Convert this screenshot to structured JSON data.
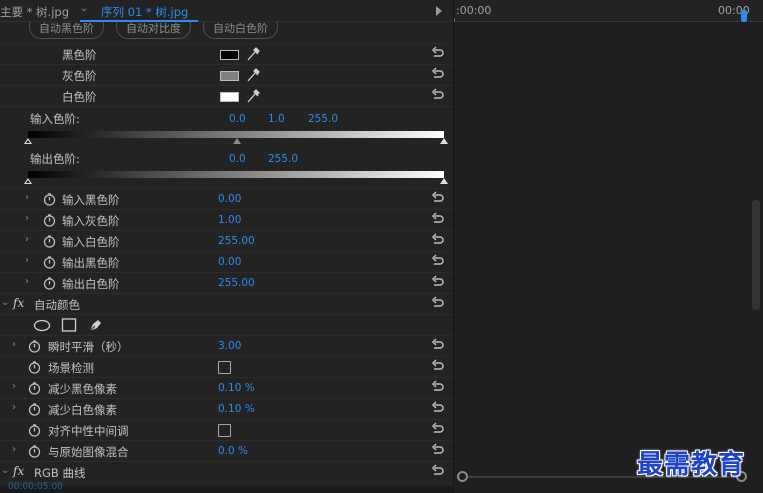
{
  "tabs": {
    "master": "主要 * 树.jpg",
    "sequence": "序列 01 * 树.jpg"
  },
  "timeline": {
    "start_tc": ":00:00",
    "end_tc": "00:00",
    "bottom_tc": "00:00:05:00"
  },
  "auto_buttons": [
    "自动黑色阶",
    "自动对比度",
    "自动白色阶"
  ],
  "levels": {
    "black_label": "黑色阶",
    "gray_label": "灰色阶",
    "white_label": "白色阶",
    "black_color": "#000000",
    "gray_color": "#808080",
    "white_color": "#ffffff"
  },
  "input_levels": {
    "label": "输入色阶:",
    "low": "0.0",
    "gamma": "1.0",
    "high": "255.0"
  },
  "output_levels": {
    "label": "输出色阶:",
    "low": "0.0",
    "high": "255.0"
  },
  "level_params": [
    {
      "label": "输入黑色阶",
      "value": "0.00"
    },
    {
      "label": "输入灰色阶",
      "value": "1.00"
    },
    {
      "label": "输入白色阶",
      "value": "255.00"
    },
    {
      "label": "输出黑色阶",
      "value": "0.00"
    },
    {
      "label": "输出白色阶",
      "value": "255.00"
    }
  ],
  "auto_color": {
    "fx": "fx",
    "title": "自动颜色",
    "params": [
      {
        "label": "瞬时平滑（秒）",
        "value": "3.00"
      },
      {
        "label": "场景检测"
      },
      {
        "label": "减少黑色像素",
        "value": "0.10 %"
      },
      {
        "label": "减少白色像素",
        "value": "0.10 %"
      },
      {
        "label": "对齐中性中间调"
      },
      {
        "label": "与原始图像混合",
        "value": "0.0 %"
      }
    ]
  },
  "rgb_curves": {
    "fx": "fx",
    "title": "RGB 曲线"
  },
  "watermark": "最需教育",
  "accent": "#2d8ceb"
}
